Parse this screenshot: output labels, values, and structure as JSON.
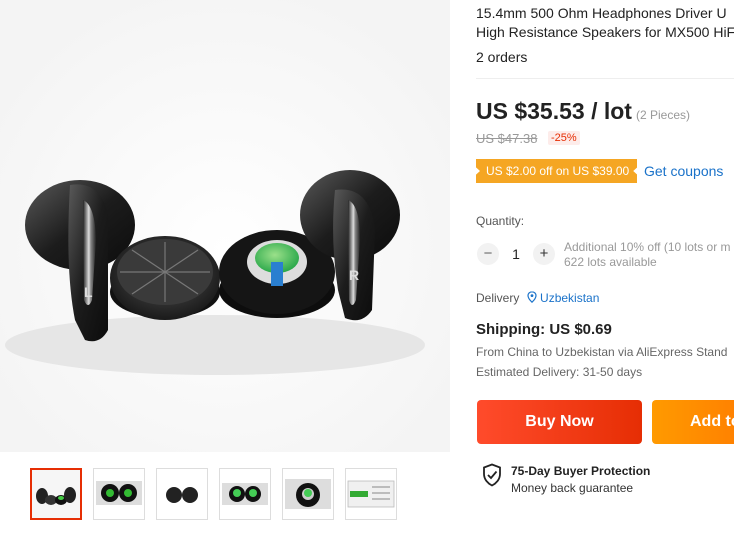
{
  "product": {
    "title_line1": "15.4mm 500 Ohm Headphones Driver U",
    "title_line2": "High Resistance Speakers for MX500 HiF",
    "orders": "2 orders",
    "price": "US $35.53 / lot",
    "pieces": "(2 Pieces)",
    "original_price": "US $47.38",
    "discount": "-25%"
  },
  "coupon": {
    "label": "US $2.00 off on US $39.00",
    "link": "Get coupons"
  },
  "quantity": {
    "label": "Quantity:",
    "minus": "−",
    "value": "1",
    "plus": "+",
    "note_line1": "Additional 10% off (10 lots or m",
    "note_line2": "622 lots available"
  },
  "delivery": {
    "label": "Delivery",
    "location": "Uzbekistan"
  },
  "shipping": {
    "title": "Shipping: US $0.69",
    "route": "From China to Uzbekistan via AliExpress Stand",
    "estimate": "Estimated Delivery: 31-50 days"
  },
  "actions": {
    "buy_now": "Buy Now",
    "add_to_cart": "Add to"
  },
  "protection": {
    "title": "75-Day Buyer Protection",
    "subtitle": "Money back guarantee"
  },
  "gallery": {
    "thumbnail_count": 6,
    "selected": 1
  },
  "colors": {
    "accent": "#e62e04",
    "coupon": "#f5a623",
    "link": "#1a72c9",
    "add_to_cart": "#ff8a00"
  }
}
